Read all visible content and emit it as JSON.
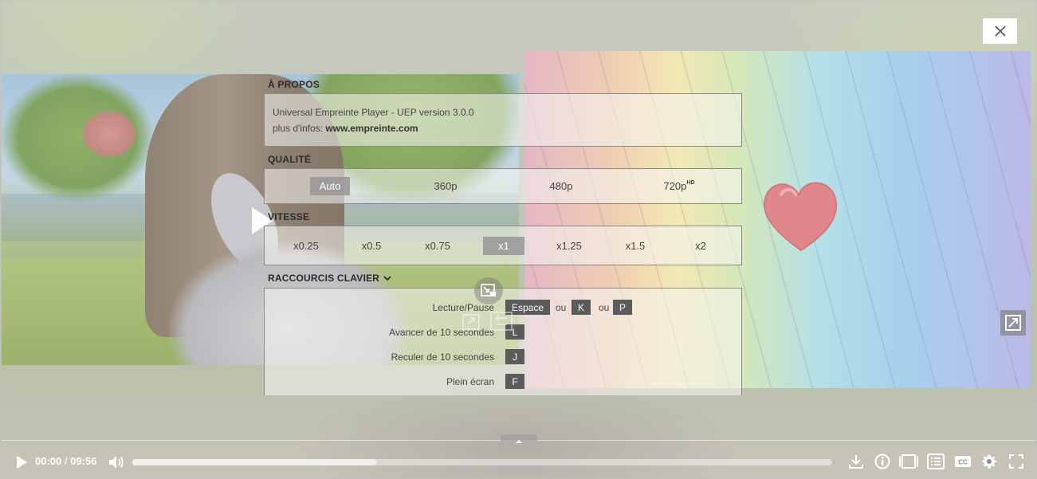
{
  "window": {
    "close_label": "close"
  },
  "about": {
    "title": "À PROPOS",
    "line1": "Universal Empreinte Player - UEP version 3.0.0",
    "line2_prefix": "plus d'infos: ",
    "line2_link": "www.empreinte.com"
  },
  "quality": {
    "title": "QUALITÉ",
    "options": [
      {
        "label": "Auto",
        "sup": ""
      },
      {
        "label": "360p",
        "sup": ""
      },
      {
        "label": "480p",
        "sup": ""
      },
      {
        "label": "720p",
        "sup": "HD"
      }
    ],
    "selected": "Auto"
  },
  "speed": {
    "title": "VITESSE",
    "options": [
      "x0.25",
      "x0.5",
      "x0.75",
      "x1",
      "x1.25",
      "x1.5",
      "x2"
    ],
    "selected": "x1"
  },
  "shortcuts": {
    "title": "RACCOURCIS CLAVIER",
    "or_label": "ou",
    "rows": [
      {
        "label": "Lecture/Pause",
        "keys": [
          "Espace",
          "K",
          "P"
        ]
      },
      {
        "label": "Avancer de 10 secondes",
        "keys": [
          "L"
        ]
      },
      {
        "label": "Reculer de 10 secondes",
        "keys": [
          "J"
        ]
      },
      {
        "label": "Plein écran",
        "keys": [
          "F"
        ]
      }
    ]
  },
  "controls": {
    "current_time": "00:00",
    "separator": " / ",
    "duration": "09:56",
    "buffered_fraction": 0.35,
    "played_fraction": 0.0,
    "icons": [
      "play-icon",
      "volume-icon",
      "download-icon",
      "info-icon",
      "layout-icon",
      "chapters-icon",
      "cc-icon",
      "gear-icon",
      "fullscreen-icon"
    ]
  },
  "colors": {
    "key_bg": "#5b5b5b",
    "selected_bg": "#969696",
    "text": "#444444"
  }
}
